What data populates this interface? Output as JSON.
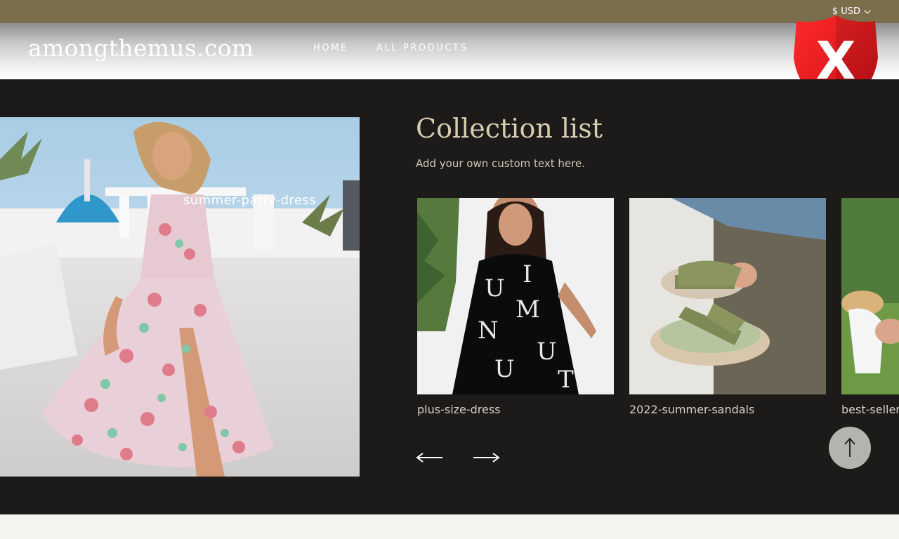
{
  "topbar": {
    "currency": "$ USD",
    "currency_icon": "chevron-down-icon"
  },
  "header": {
    "logo": "amongthemus.com",
    "nav": [
      {
        "label": "HOME"
      },
      {
        "label": "ALL PRODUCTS"
      }
    ],
    "badge_icon": "red-shield-x-icon",
    "badge_letter": "X"
  },
  "hero": {
    "caption": "summer-party-dress"
  },
  "collection": {
    "title": "Collection list",
    "subtitle": "Add your own custom text here.",
    "items": [
      {
        "label": "plus-size-dress"
      },
      {
        "label": "2022-summer-sandals"
      },
      {
        "label": "best-seller"
      }
    ],
    "prev_icon": "arrow-left-icon",
    "next_icon": "arrow-right-icon"
  },
  "scroll_top": {
    "icon": "arrow-up-icon"
  },
  "colors": {
    "topbar": "#7b6e4c",
    "main_bg": "#1c1b19",
    "title": "#d7cbb0",
    "shield_red": "#e8141e"
  }
}
